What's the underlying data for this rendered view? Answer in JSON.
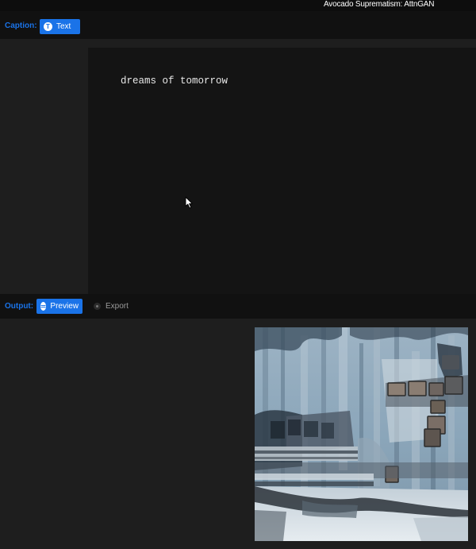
{
  "window": {
    "title": "Avocado Suprematism: AttnGAN"
  },
  "caption_section": {
    "label": "Caption:",
    "text_button": {
      "label": "Text",
      "icon": "T",
      "icon_name": "text-icon"
    },
    "caption_text": "dreams of tomorrow"
  },
  "output_section": {
    "label": "Output:",
    "preview_button": {
      "label": "Preview",
      "icon_name": "preview-icon"
    },
    "export_button": {
      "label": "Export",
      "icon_name": "export-icon"
    },
    "image_description": "generated abstract blue-grey architectural image"
  },
  "colors": {
    "accent": "#1a73e8",
    "background": "#1e1e1e",
    "bar": "#111111",
    "panel": "#141414"
  }
}
